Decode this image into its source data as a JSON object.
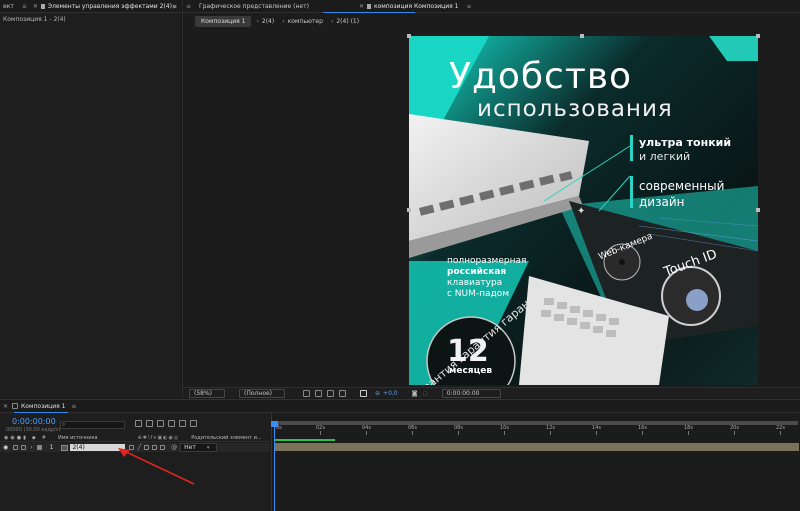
{
  "left_panel": {
    "tab_project_fragment": "ект",
    "tab_effects": "Элементы управления эффектами 2(4)",
    "breadcrumb": "Композиция 1 - 2(4)"
  },
  "viewer": {
    "tab_graphic": "Графическое представление (нет)",
    "tab_comp": "композиция Композиция 1",
    "breadcrumbs": [
      "Композиция 1",
      "2(4)",
      "компьютер",
      "2(4) (1)"
    ],
    "zoom": "(58%)",
    "quality": "(Полное)",
    "exposure": "+0,0",
    "timecode": "0:00:00:00"
  },
  "artwork": {
    "title": "Удобство",
    "subtitle": "использования",
    "feature1_bold": "ультра тонкий",
    "feature1_rest": "и легкий",
    "feature2_line1": "современный",
    "feature2_line2": "дизайн",
    "keyboard_line1": "полноразмерная",
    "keyboard_bold": "российская",
    "keyboard_line3": "клавиатура",
    "keyboard_line4": "с NUM-падом",
    "webcam": "Web-камера",
    "touchid": "Touch ID",
    "warranty_arc": "гарантия гарантия гарантия",
    "warranty_number": "12",
    "warranty_unit": "месяцев",
    "colors": {
      "teal": "#2ad4c4",
      "dark": "#0c1a1a"
    }
  },
  "timeline": {
    "tab": "Композиция 1",
    "timecode": "0:00:00:00",
    "fps_note": "00000 (30.00 кадр/с)",
    "search_placeholder": "",
    "col_name": "Имя источника",
    "col_parent": "Родительский элемент и...",
    "layer_index": "1",
    "layer_name": "2(4)",
    "layer_parent": "Нет",
    "ruler": [
      "0s",
      "02s",
      "04s",
      "06s",
      "08s",
      "10s",
      "12s",
      "14s",
      "16s",
      "18s",
      "20s",
      "22s"
    ]
  }
}
